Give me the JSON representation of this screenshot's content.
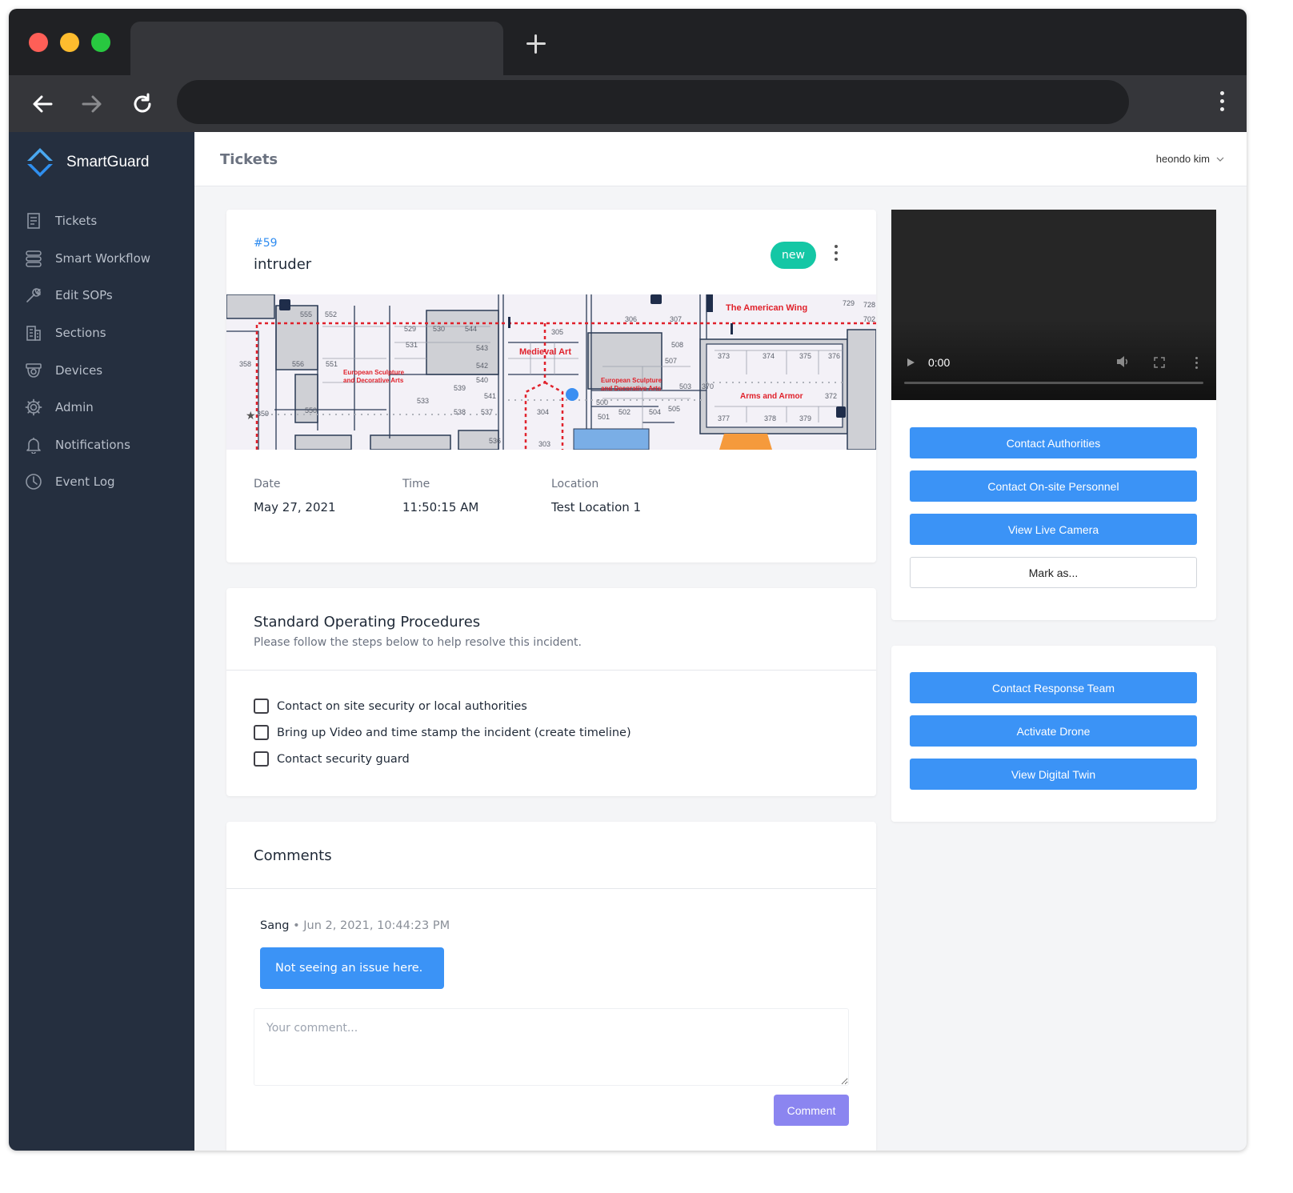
{
  "app": {
    "name": "SmartGuard"
  },
  "colors": {
    "sidebar_bg": "#252f3f",
    "accent_blue": "#3b93f6",
    "badge_green": "#14c7a5",
    "comment_button": "#8b85f0",
    "map_route": "#e0212b"
  },
  "sidebar": {
    "items": [
      {
        "label": "Tickets",
        "icon": "ticket-icon"
      },
      {
        "label": "Smart Workflow",
        "icon": "workflow-icon"
      },
      {
        "label": "Edit SOPs",
        "icon": "wrench-icon"
      },
      {
        "label": "Sections",
        "icon": "building-icon"
      },
      {
        "label": "Devices",
        "icon": "camera-icon"
      },
      {
        "label": "Admin",
        "icon": "gear-icon"
      },
      {
        "label": "Notifications",
        "icon": "bell-icon"
      },
      {
        "label": "Event Log",
        "icon": "clock-icon"
      }
    ]
  },
  "header": {
    "title": "Tickets",
    "user": "heondo kim"
  },
  "ticket": {
    "id": "#59",
    "title": "intruder",
    "status": "new",
    "date_label": "Date",
    "date": "May 27, 2021",
    "time_label": "Time",
    "time": "11:50:15 AM",
    "location_label": "Location",
    "location": "Test Location 1"
  },
  "map": {
    "labels": {
      "american_wing": "The American Wing",
      "medieval_art": "Medieval Art",
      "european_1a": "European Sculpture",
      "european_1b": "and Decorative Arts",
      "european_2a": "European Sculpture",
      "european_2b": "and Decorative Arts",
      "arms_armor": "Arms and Armor"
    },
    "rooms": [
      "555",
      "552",
      "529",
      "530",
      "544",
      "305",
      "306",
      "307",
      "729",
      "728",
      "702",
      "531",
      "543",
      "508",
      "507",
      "373",
      "374",
      "375",
      "376",
      "358",
      "556",
      "551",
      "542",
      "540",
      "539",
      "541",
      "533",
      "503",
      "370",
      "372",
      "550",
      "538",
      "537",
      "304",
      "500",
      "501",
      "502",
      "504",
      "505",
      "377",
      "378",
      "379",
      "359",
      "536",
      "303"
    ]
  },
  "sop": {
    "title": "Standard Operating Procedures",
    "subtitle": "Please follow the steps below to help resolve this incident.",
    "steps": [
      "Contact on site security or local authorities",
      "Bring up Video and time stamp the incident (create timeline)",
      "Contact security guard"
    ]
  },
  "comments": {
    "title": "Comments",
    "items": [
      {
        "author": "Sang",
        "separator": " • ",
        "time": "Jun 2, 2021, 10:44:23 PM",
        "text": "Not seeing an issue here."
      }
    ],
    "placeholder": "Your comment...",
    "submit_label": "Comment"
  },
  "video": {
    "time": "0:00",
    "progress": 0
  },
  "actions": {
    "contact_authorities": "Contact Authorities",
    "contact_onsite": "Contact On-site Personnel",
    "view_live_camera": "View Live Camera",
    "mark_as": "Mark as...",
    "contact_response_team": "Contact Response Team",
    "activate_drone": "Activate Drone",
    "view_digital_twin": "View Digital Twin"
  }
}
